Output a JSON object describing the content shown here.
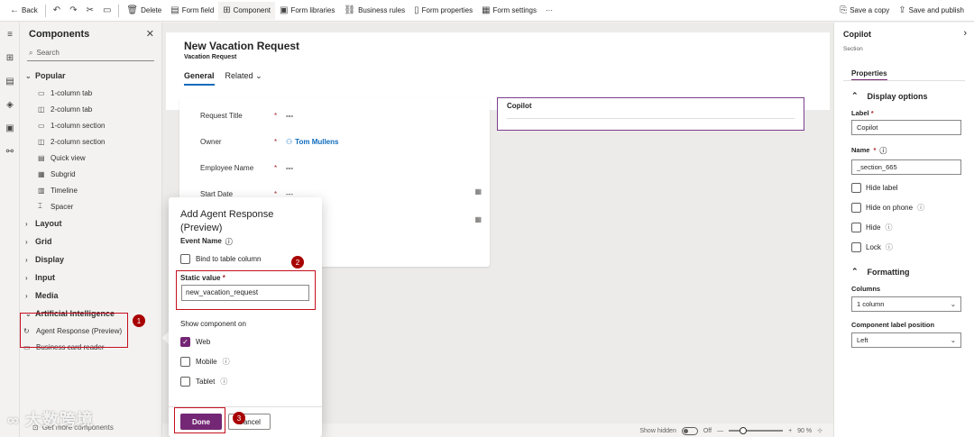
{
  "toolbar": {
    "back": "Back",
    "delete": "Delete",
    "form_field": "Form field",
    "component": "Component",
    "form_libraries": "Form libraries",
    "business_rules": "Business rules",
    "form_properties": "Form properties",
    "form_settings": "Form settings",
    "more": "···",
    "save_copy": "Save a copy",
    "save_publish": "Save and publish"
  },
  "components": {
    "title": "Components",
    "search_placeholder": "Search",
    "popular": "Popular",
    "items": [
      "1-column tab",
      "2-column tab",
      "1-column section",
      "2-column section",
      "Quick view",
      "Subgrid",
      "Timeline",
      "Spacer"
    ],
    "groups": [
      "Layout",
      "Grid",
      "Display",
      "Input",
      "Media"
    ],
    "ai_group": "Artificial Intelligence",
    "ai_item": "Agent Response (Preview)",
    "business_card": "Business card reader",
    "get_more": "Get more components"
  },
  "form": {
    "title": "New Vacation Request",
    "subtitle": "Vacation Request",
    "tab_general": "General",
    "tab_related": "Related",
    "fields": [
      {
        "label": "Request Title",
        "value": "---"
      },
      {
        "label": "Owner",
        "value": "Tom Mullens"
      },
      {
        "label": "Employee Name",
        "value": "---"
      },
      {
        "label": "Start Date",
        "value": "---"
      }
    ],
    "required_mark": "*",
    "copilot_section": "Copilot"
  },
  "status": {
    "show_hidden": "Show hidden",
    "toggle_state": "Off",
    "zoom": "90 %"
  },
  "popup": {
    "title": "Add Agent Response (Preview)",
    "event_name": "Event Name",
    "bind_column": "Bind to table column",
    "static_label": "Static value",
    "static_value": "new_vacation_request",
    "show_on": "Show component on",
    "web": "Web",
    "mobile": "Mobile",
    "tablet": "Tablet",
    "done": "Done",
    "cancel": "Cancel"
  },
  "badges": [
    "1",
    "2",
    "3"
  ],
  "props": {
    "title": "Copilot",
    "subtitle": "Section",
    "tab": "Properties",
    "display_options": "Display options",
    "label_lab": "Label",
    "label_val": "Copilot",
    "name_lab": "Name",
    "name_val": "_section_665",
    "hide_label": "Hide label",
    "hide_phone": "Hide on phone",
    "hide": "Hide",
    "lock": "Lock",
    "formatting": "Formatting",
    "columns_lab": "Columns",
    "columns_val": "1 column",
    "pos_lab": "Component label position",
    "pos_val": "Left"
  },
  "watermark": "大数跨境",
  "colors": {
    "accent": "#742774",
    "annotation": "#c50f1f",
    "link": "#0f6cbd"
  }
}
